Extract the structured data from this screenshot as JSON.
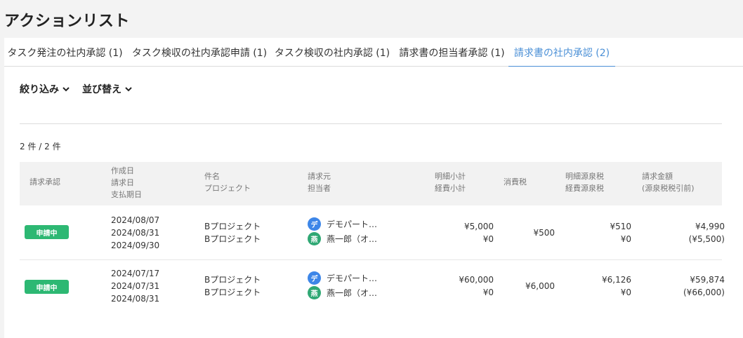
{
  "page": {
    "title": "アクションリスト"
  },
  "tabs": [
    {
      "label": "タスク発注の社内承認 (1)",
      "active": false
    },
    {
      "label": "タスク検収の社内承認申請 (1)",
      "active": false
    },
    {
      "label": "タスク検収の社内承認 (1)",
      "active": false
    },
    {
      "label": "請求書の担当者承認 (1)",
      "active": false
    },
    {
      "label": "請求書の社内承認 (2)",
      "active": true
    }
  ],
  "toolbar": {
    "filter_label": "絞り込み",
    "sort_label": "並び替え"
  },
  "result_count": "2 件 / 2 件",
  "table": {
    "headers": {
      "approval": "請求承認",
      "dates": [
        "作成日",
        "請求日",
        "支払期日"
      ],
      "subject": [
        "件名",
        "プロジェクト"
      ],
      "billing": [
        "請求元",
        "担当者"
      ],
      "subtotal": [
        "明細小計",
        "経費小計"
      ],
      "tax": "消費税",
      "withholding": [
        "明細源泉税",
        "経費源泉税"
      ],
      "amount": [
        "請求金額",
        "(源泉税税引前)"
      ]
    },
    "rows": [
      {
        "status": "申請中",
        "created": "2024/08/07",
        "billed": "2024/08/31",
        "due": "2024/09/30",
        "subject": "Bプロジェクト",
        "project": "Bプロジェクト",
        "vendor_initial": "デ",
        "vendor_name": "デモパート…",
        "person_initial": "燕",
        "person_name": "燕一郎（オ…",
        "item_subtotal": "¥5,000",
        "expense_subtotal": "¥0",
        "tax": "¥500",
        "item_withholding": "¥510",
        "expense_withholding": "¥0",
        "amount": "¥4,990",
        "amount_before": "(¥5,500)"
      },
      {
        "status": "申請中",
        "created": "2024/07/17",
        "billed": "2024/07/31",
        "due": "2024/08/31",
        "subject": "Bプロジェクト",
        "project": "Bプロジェクト",
        "vendor_initial": "デ",
        "vendor_name": "デモパート…",
        "person_initial": "燕",
        "person_name": "燕一郎（オ…",
        "item_subtotal": "¥60,000",
        "expense_subtotal": "¥0",
        "tax": "¥6,000",
        "item_withholding": "¥6,126",
        "expense_withholding": "¥0",
        "amount": "¥59,874",
        "amount_before": "(¥66,000)"
      }
    ]
  },
  "colors": {
    "accent": "#4a8fd6",
    "status_green": "#2db873",
    "vendor_avatar": "#3d86e8",
    "person_avatar": "#2fa874"
  }
}
